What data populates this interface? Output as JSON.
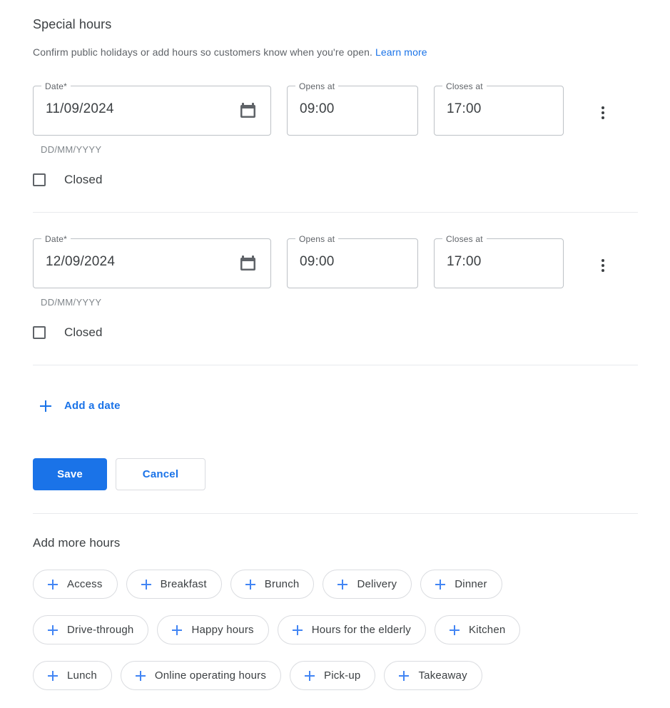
{
  "header": {
    "title": "Special hours",
    "description": "Confirm public holidays or add hours so customers know when you're open.",
    "learn_more": "Learn more"
  },
  "field_labels": {
    "date": "Date*",
    "opens_at": "Opens at",
    "closes_at": "Closes at",
    "date_helper": "DD/MM/YYYY",
    "closed": "Closed"
  },
  "icons": {
    "calendar": "calendar-icon",
    "kebab": "more-options-icon",
    "plus": "plus-icon"
  },
  "rows": [
    {
      "date": "11/09/2024",
      "opens_at": "09:00",
      "closes_at": "17:00",
      "helper": "DD/MM/YYYY",
      "closed_label": "Closed",
      "closed_checked": false
    },
    {
      "date": "12/09/2024",
      "opens_at": "09:00",
      "closes_at": "17:00",
      "helper": "DD/MM/YYYY",
      "closed_label": "Closed",
      "closed_checked": false
    }
  ],
  "actions": {
    "add_date": "Add a date",
    "save": "Save",
    "cancel": "Cancel"
  },
  "add_more_hours": {
    "title": "Add more hours",
    "rows": [
      [
        "Access",
        "Breakfast",
        "Brunch",
        "Delivery",
        "Dinner"
      ],
      [
        "Drive-through",
        "Happy hours",
        "Hours for the elderly",
        "Kitchen"
      ],
      [
        "Lunch",
        "Online operating hours",
        "Pick-up",
        "Takeaway"
      ]
    ]
  },
  "colors": {
    "accent": "#1a73e8",
    "chip_plus": "#4285f4",
    "text": "#3c4043",
    "muted": "#5f6368",
    "border": "#bdc1c6",
    "divider": "#e8eaed"
  }
}
